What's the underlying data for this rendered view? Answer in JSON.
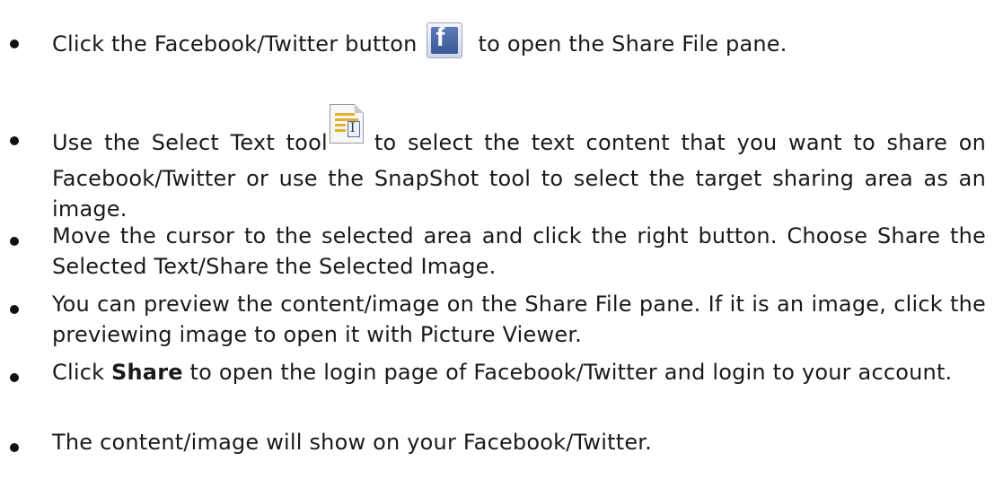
{
  "bullets": [
    {
      "before_icon": "Click the Facebook/Twitter button",
      "icon": "facebook-icon",
      "icon_letter": "f",
      "after_icon": "to open the Share File pane."
    },
    {
      "before_icon": "Use the Select Text tool",
      "icon": "select-text-tool-icon",
      "icon_letter": "I",
      "after_icon": "to select the text content that you want to share on Facebook/Twitter or use the SnapShot tool to select the target sharing area as an image."
    },
    {
      "text": "Move the cursor to the selected area and click the right button. Choose Share the Selected Text/Share the Selected Image."
    },
    {
      "text": "You can preview the content/image on the Share File pane. If it is an image, click the previewing image to open it with Picture Viewer."
    },
    {
      "before_bold": "Click ",
      "bold": "Share",
      "after_bold": " to open the login page of Facebook/Twitter and login to your account."
    },
    {
      "text": "The content/image will show on your Facebook/Twitter."
    }
  ],
  "colors": {
    "facebook_blue": "#3b5998",
    "highlight_lines": "#e2b12a"
  }
}
